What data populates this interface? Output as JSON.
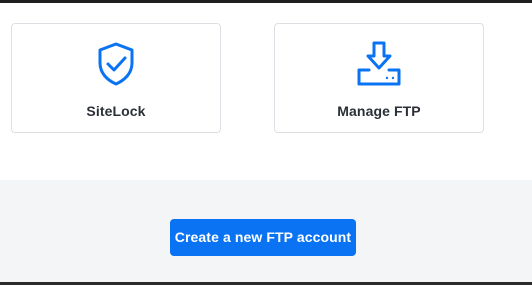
{
  "cards": [
    {
      "label": "SiteLock",
      "icon": "shield-check-icon"
    },
    {
      "label": "Manage FTP",
      "icon": "download-server-icon"
    }
  ],
  "cta": {
    "label": "Create a new FTP account"
  },
  "colors": {
    "accent": "#0a73f4",
    "card_border": "#dcdfe3",
    "band_background": "#f3f5f6",
    "label_text": "#2b2f36"
  }
}
